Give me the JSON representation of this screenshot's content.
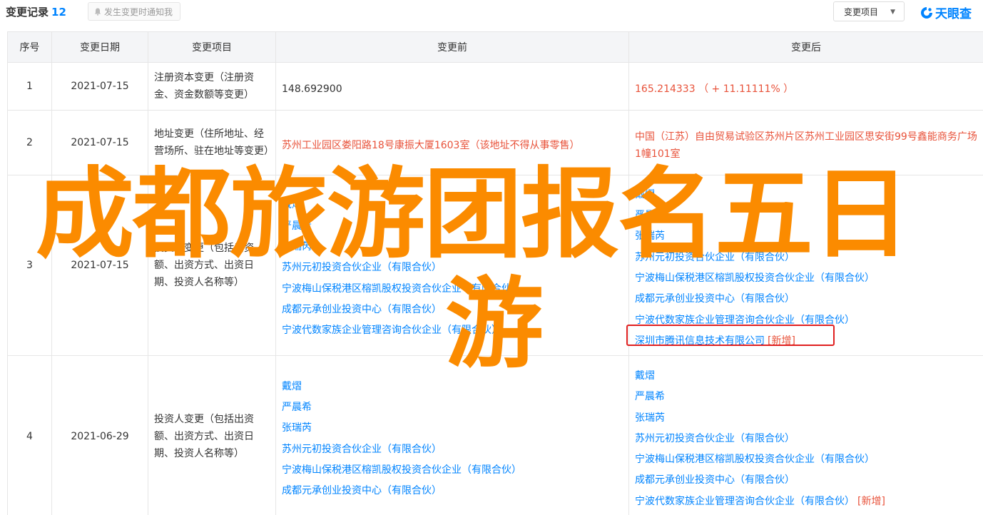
{
  "header": {
    "title": "变更记录",
    "count": "12",
    "notify_label": "发生变更时通知我",
    "select_label": "变更项目",
    "logo_text": "天眼查"
  },
  "table": {
    "columns": [
      "序号",
      "变更日期",
      "变更项目",
      "变更前",
      "变更后"
    ],
    "rows": [
      {
        "seq": "1",
        "date": "2021-07-15",
        "item": "注册资本变更（注册资金、资金数额等变更）",
        "before": "148.692900",
        "after": "165.214333 （ + 11.11111% ）"
      },
      {
        "seq": "2",
        "date": "2021-07-15",
        "item": "地址变更（住所地址、经营场所、驻在地址等变更）",
        "before": "苏州工业园区娄阳路18号康振大厦1603室（该地址不得从事零售）",
        "after": "中国（江苏）自由贸易试验区苏州片区苏州工业园区思安街99号鑫能商务广场1幢101室"
      },
      {
        "seq": "3",
        "date": "2021-07-15",
        "item": "投资人变更（包括出资额、出资方式、出资日期、投资人名称等）",
        "before": [
          "戴熠",
          "严晨希",
          "张瑞芮",
          "苏州元初投资合伙企业（有限合伙）",
          "宁波梅山保税港区榕凯股权投资合伙企业（有限合伙）",
          "成都元承创业投资中心（有限合伙）",
          "宁波代数家族企业管理咨询合伙企业（有限合伙）"
        ],
        "after": [
          "戴熠",
          "严晨希",
          "张瑞芮",
          "苏州元初投资合伙企业（有限合伙）",
          "宁波梅山保税港区榕凯股权投资合伙企业（有限合伙）",
          "成都元承创业投资中心（有限合伙）",
          "宁波代数家族企业管理咨询合伙企业（有限合伙）",
          "深圳市腾讯信息技术有限公司"
        ],
        "new_tag": "[新增]"
      },
      {
        "seq": "4",
        "date": "2021-06-29",
        "item": "投资人变更（包括出资额、出资方式、出资日期、投资人名称等）",
        "before": [
          "戴熠",
          "严晨希",
          "张瑞芮",
          "苏州元初投资合伙企业（有限合伙）",
          "宁波梅山保税港区榕凯股权投资合伙企业（有限合伙）",
          "成都元承创业投资中心（有限合伙）"
        ],
        "after": [
          "戴熠",
          "严晨希",
          "张瑞芮",
          "苏州元初投资合伙企业（有限合伙）",
          "宁波梅山保税港区榕凯股权投资合伙企业（有限合伙）",
          "成都元承创业投资中心（有限合伙）",
          "宁波代数家族企业管理咨询合伙企业（有限合伙）"
        ],
        "new_tag": "[新增]"
      }
    ]
  },
  "watermark": {
    "line1": "成都旅游团报名五日",
    "line2": "游"
  },
  "colors": {
    "accent": "#0084ff",
    "change": "#e8523a",
    "highlight": "#e02020",
    "watermark": "#fb8b00"
  }
}
